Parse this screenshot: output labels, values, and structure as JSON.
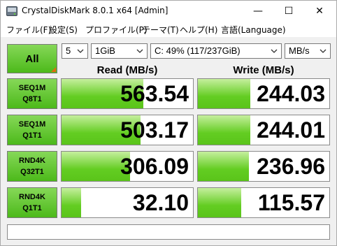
{
  "window": {
    "title": "CrystalDiskMark 8.0.1 x64 [Admin]",
    "minimize_glyph": "—",
    "maximize_glyph": "☐",
    "close_glyph": "✕"
  },
  "menu": [
    {
      "label": "ファイル(F)"
    },
    {
      "label": "設定(S)"
    },
    {
      "label": "プロファイル(P)"
    },
    {
      "label": "テーマ(T)"
    },
    {
      "label": "ヘルプ(H)"
    },
    {
      "label": "言語(Language)"
    }
  ],
  "controls": {
    "all_label": "All",
    "count_value": "5",
    "size_value": "1GiB",
    "drive_value": "C: 49% (117/237GiB)",
    "unit_value": "MB/s"
  },
  "headers": {
    "read": "Read (MB/s)",
    "write": "Write (MB/s)"
  },
  "rows": [
    {
      "line1": "SEQ1M",
      "line2": "Q8T1",
      "read": "563.54",
      "write": "244.03",
      "read_fill": 0.62,
      "write_fill": 0.4
    },
    {
      "line1": "SEQ1M",
      "line2": "Q1T1",
      "read": "503.17",
      "write": "244.01",
      "read_fill": 0.6,
      "write_fill": 0.4
    },
    {
      "line1": "RND4K",
      "line2": "Q32T1",
      "read": "306.09",
      "write": "236.96",
      "read_fill": 0.52,
      "write_fill": 0.39
    },
    {
      "line1": "RND4K",
      "line2": "Q1T1",
      "read": "32.10",
      "write": "115.57",
      "read_fill": 0.15,
      "write_fill": 0.33
    }
  ],
  "colors": {
    "button_green": "#4cb91a",
    "bar_green": "#63cd22",
    "all_corner_orange": "#e06a10"
  },
  "comment": ""
}
